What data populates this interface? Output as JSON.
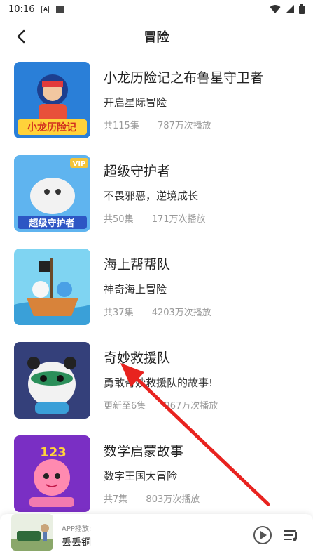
{
  "status": {
    "time": "10:16"
  },
  "header": {
    "title": "冒险"
  },
  "items": [
    {
      "name": "小龙历险记之布鲁星守卫者",
      "desc": "开启星际冒险",
      "episodes": "共115集",
      "plays": "787万次播放",
      "cover_text": "小龙历险记",
      "badge": ""
    },
    {
      "name": "超级守护者",
      "desc": "不畏邪恶，逆境成长",
      "episodes": "共50集",
      "plays": "171万次播放",
      "cover_text": "超级守护者",
      "badge": "VIP"
    },
    {
      "name": "海上帮帮队",
      "desc": "神奇海上冒险",
      "episodes": "共37集",
      "plays": "4203万次播放",
      "cover_text": "",
      "badge": ""
    },
    {
      "name": "奇妙救援队",
      "desc": "勇敢奇妙救援队的故事!",
      "episodes": "更新至6集",
      "plays": "967万次播放",
      "cover_text": "",
      "badge": ""
    },
    {
      "name": "数学启蒙故事",
      "desc": "数字王国大冒险",
      "episodes": "共7集",
      "plays": "803万次播放",
      "cover_text": "123",
      "badge": ""
    }
  ],
  "player": {
    "label": "APP播放:",
    "song": "丢丢铜"
  },
  "colors": {
    "annotation_arrow": "#e8231f"
  },
  "icons": [
    "back-arrow-icon",
    "wifi-icon",
    "signal-icon",
    "battery-icon",
    "play-icon",
    "playlist-icon"
  ]
}
